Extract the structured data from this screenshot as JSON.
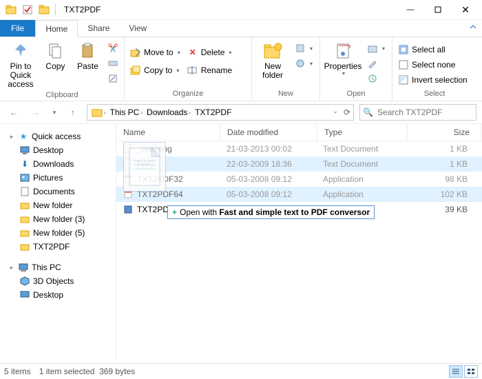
{
  "title": "TXT2PDF",
  "tabs": {
    "file": "File",
    "home": "Home",
    "share": "Share",
    "view": "View"
  },
  "ribbon": {
    "clipboard": {
      "label": "Clipboard",
      "pin": "Pin to Quick access",
      "copy": "Copy",
      "paste": "Paste"
    },
    "organize": {
      "label": "Organize",
      "moveto": "Move to",
      "copyto": "Copy to",
      "delete": "Delete",
      "rename": "Rename"
    },
    "new": {
      "label": "New",
      "newfolder": "New folder"
    },
    "open": {
      "label": "Open",
      "properties": "Properties"
    },
    "select": {
      "label": "Select",
      "all": "Select all",
      "none": "Select none",
      "invert": "Invert selection"
    }
  },
  "breadcrumb": [
    "This PC",
    "Downloads",
    "TXT2PDF"
  ],
  "search_placeholder": "Search TXT2PDF",
  "sidebar": {
    "quick": "Quick access",
    "items": [
      "Desktop",
      "Downloads",
      "Pictures",
      "Documents",
      "New folder",
      "New folder (3)",
      "New folder (5)",
      "TXT2PDF"
    ],
    "thispc": "This PC",
    "pcitems": [
      "3D Objects",
      "Desktop"
    ]
  },
  "columns": {
    "name": "Name",
    "date": "Date modified",
    "type": "Type",
    "size": "Size"
  },
  "files": [
    {
      "name": "_updating",
      "date": "21-03-2013 00:02",
      "type": "Text Document",
      "size": "1 KB",
      "sel": false,
      "ghost": true
    },
    {
      "name": "TWC",
      "date": "22-03-2009 18:36",
      "type": "Text Document",
      "size": "1 KB",
      "sel": true,
      "ghost": true
    },
    {
      "name": "TXT2PDF32",
      "date": "05-03-2008 09:12",
      "type": "Application",
      "size": "98 KB",
      "sel": false,
      "ghost": true
    },
    {
      "name": "TXT2PDF64",
      "date": "05-03-2008 09:12",
      "type": "Application",
      "size": "102 KB",
      "sel": true,
      "ghost": true
    },
    {
      "name": "TXT2PDF",
      "date": "",
      "type": "",
      "size": "39 KB",
      "sel": false,
      "ghost": false
    }
  ],
  "dragtip": {
    "prefix": "Open with",
    "target": "Fast and simple text to PDF conversor"
  },
  "status": {
    "count": "5 items",
    "sel": "1 item selected",
    "size": "369 bytes"
  }
}
